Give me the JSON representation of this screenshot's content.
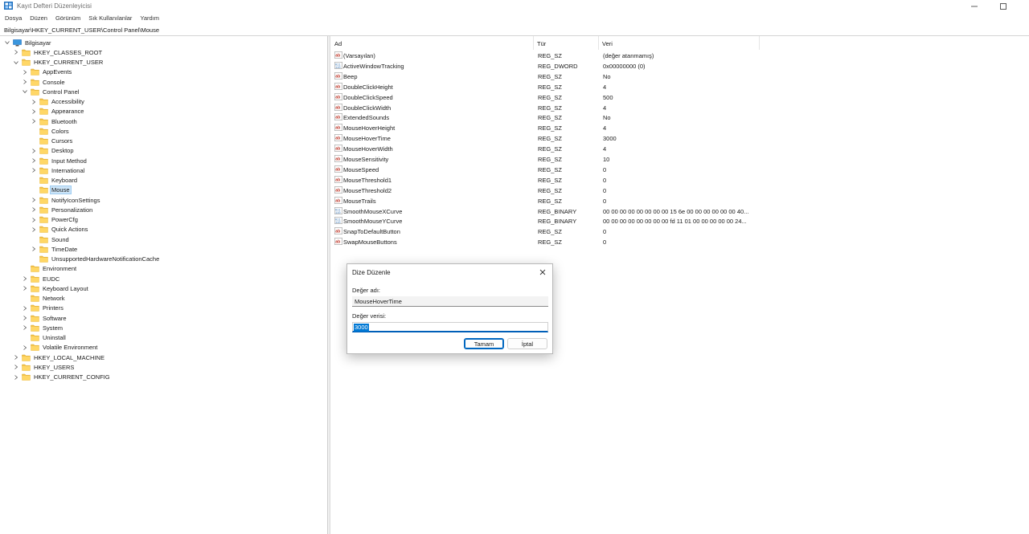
{
  "window": {
    "title": "Kayıt Defteri Düzenleyicisi",
    "controls": [
      "minimize-icon",
      "maximize-icon"
    ]
  },
  "menu": [
    "Dosya",
    "Düzen",
    "Görünüm",
    "Sık Kullanılanlar",
    "Yardım"
  ],
  "address": "Bilgisayar\\HKEY_CURRENT_USER\\Control Panel\\Mouse",
  "tree": [
    {
      "label": "Bilgisayar",
      "depth": 0,
      "expander": "open",
      "icon": "computer-icon"
    },
    {
      "label": "HKEY_CLASSES_ROOT",
      "depth": 1,
      "expander": "closed"
    },
    {
      "label": "HKEY_CURRENT_USER",
      "depth": 1,
      "expander": "open"
    },
    {
      "label": "AppEvents",
      "depth": 2,
      "expander": "closed"
    },
    {
      "label": "Console",
      "depth": 2,
      "expander": "closed"
    },
    {
      "label": "Control Panel",
      "depth": 2,
      "expander": "open"
    },
    {
      "label": "Accessibility",
      "depth": 3,
      "expander": "closed"
    },
    {
      "label": "Appearance",
      "depth": 3,
      "expander": "closed"
    },
    {
      "label": "Bluetooth",
      "depth": 3,
      "expander": "closed"
    },
    {
      "label": "Colors",
      "depth": 3,
      "expander": "none"
    },
    {
      "label": "Cursors",
      "depth": 3,
      "expander": "none"
    },
    {
      "label": "Desktop",
      "depth": 3,
      "expander": "closed"
    },
    {
      "label": "Input Method",
      "depth": 3,
      "expander": "closed"
    },
    {
      "label": "International",
      "depth": 3,
      "expander": "closed"
    },
    {
      "label": "Keyboard",
      "depth": 3,
      "expander": "none"
    },
    {
      "label": "Mouse",
      "depth": 3,
      "expander": "none",
      "selected": true
    },
    {
      "label": "NotifyIconSettings",
      "depth": 3,
      "expander": "closed"
    },
    {
      "label": "Personalization",
      "depth": 3,
      "expander": "closed"
    },
    {
      "label": "PowerCfg",
      "depth": 3,
      "expander": "closed"
    },
    {
      "label": "Quick Actions",
      "depth": 3,
      "expander": "closed"
    },
    {
      "label": "Sound",
      "depth": 3,
      "expander": "none"
    },
    {
      "label": "TimeDate",
      "depth": 3,
      "expander": "closed"
    },
    {
      "label": "UnsupportedHardwareNotificationCache",
      "depth": 3,
      "expander": "none"
    },
    {
      "label": "Environment",
      "depth": 2,
      "expander": "none"
    },
    {
      "label": "EUDC",
      "depth": 2,
      "expander": "closed"
    },
    {
      "label": "Keyboard Layout",
      "depth": 2,
      "expander": "closed"
    },
    {
      "label": "Network",
      "depth": 2,
      "expander": "none"
    },
    {
      "label": "Printers",
      "depth": 2,
      "expander": "closed"
    },
    {
      "label": "Software",
      "depth": 2,
      "expander": "closed"
    },
    {
      "label": "System",
      "depth": 2,
      "expander": "closed"
    },
    {
      "label": "Uninstall",
      "depth": 2,
      "expander": "none"
    },
    {
      "label": "Volatile Environment",
      "depth": 2,
      "expander": "closed"
    },
    {
      "label": "HKEY_LOCAL_MACHINE",
      "depth": 1,
      "expander": "closed"
    },
    {
      "label": "HKEY_USERS",
      "depth": 1,
      "expander": "closed"
    },
    {
      "label": "HKEY_CURRENT_CONFIG",
      "depth": 1,
      "expander": "closed"
    }
  ],
  "columns": {
    "name": "Ad",
    "type": "Tür",
    "data": "Veri"
  },
  "values": [
    {
      "name": "(Varsayılan)",
      "type": "REG_SZ",
      "data": "(değer atanmamış)",
      "icon": "string-value-icon"
    },
    {
      "name": "ActiveWindowTracking",
      "type": "REG_DWORD",
      "data": "0x00000000 (0)",
      "icon": "binary-value-icon"
    },
    {
      "name": "Beep",
      "type": "REG_SZ",
      "data": "No",
      "icon": "string-value-icon"
    },
    {
      "name": "DoubleClickHeight",
      "type": "REG_SZ",
      "data": "4",
      "icon": "string-value-icon"
    },
    {
      "name": "DoubleClickSpeed",
      "type": "REG_SZ",
      "data": "500",
      "icon": "string-value-icon"
    },
    {
      "name": "DoubleClickWidth",
      "type": "REG_SZ",
      "data": "4",
      "icon": "string-value-icon"
    },
    {
      "name": "ExtendedSounds",
      "type": "REG_SZ",
      "data": "No",
      "icon": "string-value-icon"
    },
    {
      "name": "MouseHoverHeight",
      "type": "REG_SZ",
      "data": "4",
      "icon": "string-value-icon"
    },
    {
      "name": "MouseHoverTime",
      "type": "REG_SZ",
      "data": "3000",
      "icon": "string-value-icon"
    },
    {
      "name": "MouseHoverWidth",
      "type": "REG_SZ",
      "data": "4",
      "icon": "string-value-icon"
    },
    {
      "name": "MouseSensitivity",
      "type": "REG_SZ",
      "data": "10",
      "icon": "string-value-icon"
    },
    {
      "name": "MouseSpeed",
      "type": "REG_SZ",
      "data": "0",
      "icon": "string-value-icon"
    },
    {
      "name": "MouseThreshold1",
      "type": "REG_SZ",
      "data": "0",
      "icon": "string-value-icon"
    },
    {
      "name": "MouseThreshold2",
      "type": "REG_SZ",
      "data": "0",
      "icon": "string-value-icon"
    },
    {
      "name": "MouseTrails",
      "type": "REG_SZ",
      "data": "0",
      "icon": "string-value-icon"
    },
    {
      "name": "SmoothMouseXCurve",
      "type": "REG_BINARY",
      "data": "00 00 00 00 00 00 00 00 15 6e 00 00 00 00 00 00 40...",
      "icon": "binary-value-icon"
    },
    {
      "name": "SmoothMouseYCurve",
      "type": "REG_BINARY",
      "data": "00 00 00 00 00 00 00 00 fd 11 01 00 00 00 00 00 24...",
      "icon": "binary-value-icon"
    },
    {
      "name": "SnapToDefaultButton",
      "type": "REG_SZ",
      "data": "0",
      "icon": "string-value-icon"
    },
    {
      "name": "SwapMouseButtons",
      "type": "REG_SZ",
      "data": "0",
      "icon": "string-value-icon"
    }
  ],
  "dialog": {
    "title": "Dize Düzenle",
    "name_label": "Değer adı:",
    "name_value": "MouseHoverTime",
    "data_label": "Değer verisi:",
    "data_value": "3000",
    "ok_label": "Tamam",
    "cancel_label": "İptal"
  },
  "colors": {
    "selection": "#cce4f7",
    "folder": "#f4c44e",
    "accent": "#0078d4",
    "string_icon": "#c0392b",
    "binary_icon": "#2b6cb0"
  }
}
